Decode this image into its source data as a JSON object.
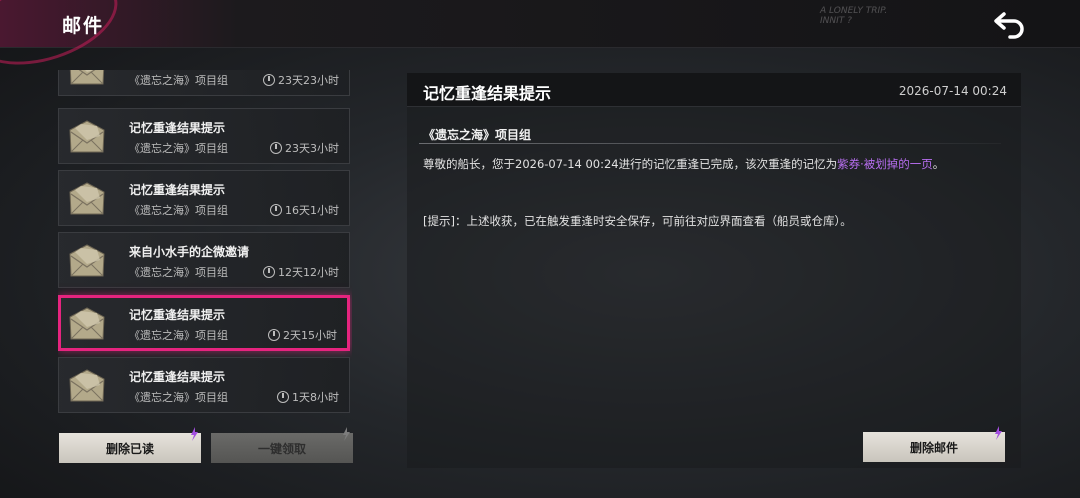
{
  "header": {
    "title": "邮件",
    "deco_text_line1": "A LONELY TRIP.",
    "deco_text_line2": "INNIT ?"
  },
  "mail_list": [
    {
      "title": "",
      "from": "《遗忘之海》项目组",
      "time": "23天23小时",
      "partial": true
    },
    {
      "title": "记忆重逢结果提示",
      "from": "《遗忘之海》项目组",
      "time": "23天3小时"
    },
    {
      "title": "记忆重逢结果提示",
      "from": "《遗忘之海》项目组",
      "time": "16天1小时"
    },
    {
      "title": "来自小水手的企微邀请",
      "from": "《遗忘之海》项目组",
      "time": "12天12小时"
    },
    {
      "title": "记忆重逢结果提示",
      "from": "《遗忘之海》项目组",
      "time": "2天15小时",
      "selected": true
    },
    {
      "title": "记忆重逢结果提示",
      "from": "《遗忘之海》项目组",
      "time": "1天8小时"
    }
  ],
  "buttons": {
    "delete_read": "删除已读",
    "collect_all": "一键领取",
    "delete_mail": "删除邮件"
  },
  "detail": {
    "title": "记忆重逢结果提示",
    "date": "2026-07-14 00:24",
    "sender": "《遗忘之海》项目组",
    "body_prefix": "尊敬的船长，您于2026-07-14 00:24进行的记忆重逢已完成，该次重逢的记忆为",
    "body_highlight": "紫券·被划掉的一页",
    "body_suffix": "。",
    "note": "[提示]：上述收获，已在触发重逢时安全保存，可前往对应界面查看（船员或仓库）。"
  },
  "colors": {
    "accent": "#e6247f",
    "highlight": "#b86ef0"
  },
  "icons": [
    "back-arrow-icon",
    "envelope-icon",
    "clock-icon",
    "spark-icon"
  ]
}
